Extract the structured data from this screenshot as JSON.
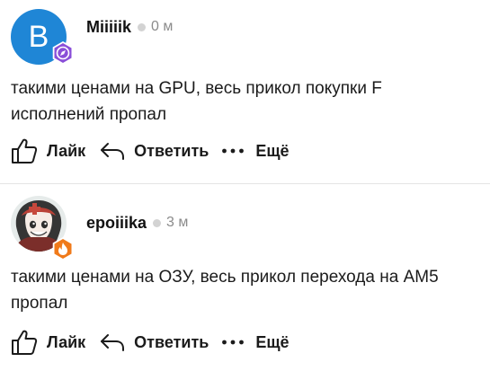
{
  "comments": [
    {
      "author": "Miiiiik",
      "time": "0 м",
      "avatar_letter": "B",
      "avatar_color": "#1f86d6",
      "badge_color": "#8a4fd8",
      "badge_icon": "compass-icon",
      "text": "такими ценами на GPU, весь прикол покупки F исполнений пропал",
      "actions": {
        "like": "Лайк",
        "reply": "Ответить",
        "more": "Ещё"
      }
    },
    {
      "author": "epoiiika",
      "time": "3 м",
      "avatar_image": "anime-character-avatar",
      "badge_color": "#f07a1a",
      "badge_icon": "flame-icon",
      "text": "такими ценами на ОЗУ, весь прикол перехода на AM5 пропал",
      "actions": {
        "like": "Лайк",
        "reply": "Ответить",
        "more": "Ещё"
      }
    }
  ]
}
